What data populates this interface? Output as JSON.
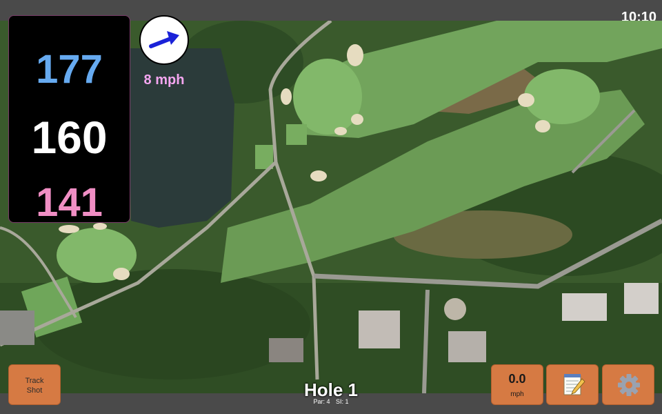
{
  "status_bar": {
    "time": "10:10"
  },
  "distances": {
    "back": "177",
    "middle": "160",
    "front": "141"
  },
  "wind": {
    "speed": "8 mph",
    "arrow_icon": "wind-arrow-icon"
  },
  "buttons": {
    "track_shot": "Track\nShot",
    "speed_value": "0.0",
    "speed_unit": "mph",
    "notes_icon": "notepad-icon",
    "settings_icon": "gear-icon"
  },
  "hole": {
    "title": "Hole 1",
    "par": "Par: 4",
    "si": "SI: 1"
  },
  "colors": {
    "back": "#66aaf0",
    "middle": "#ffffff",
    "front": "#f08ec4",
    "button": "#d67a43",
    "wind_text": "#f4a6f0"
  }
}
